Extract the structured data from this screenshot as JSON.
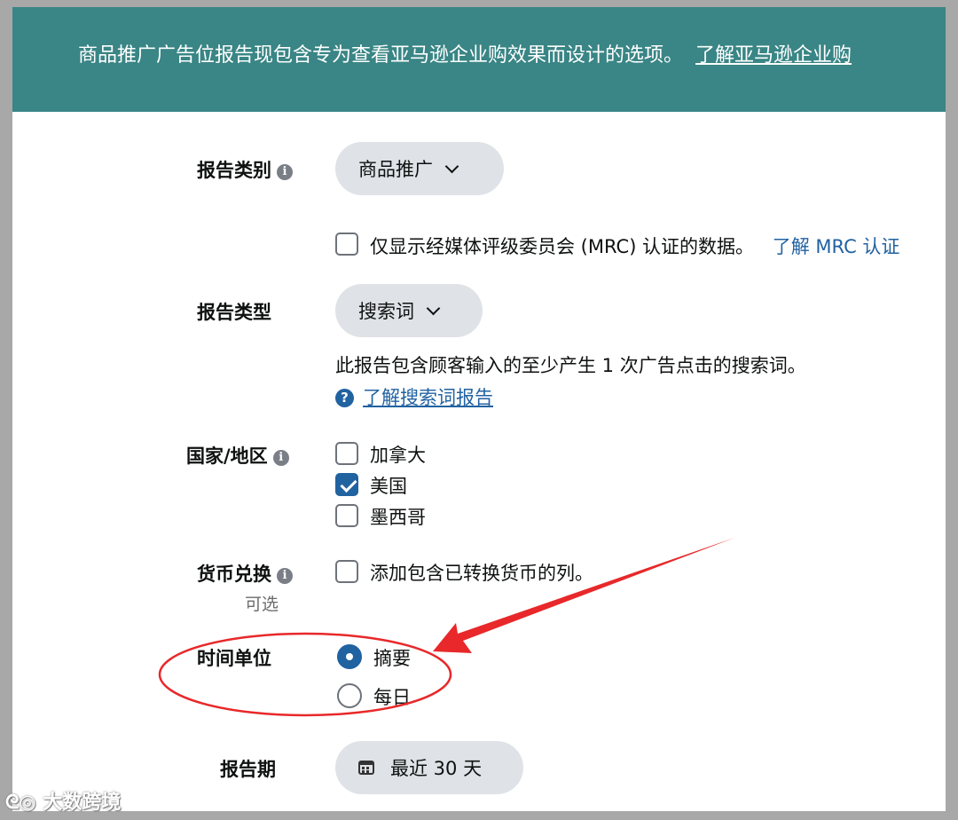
{
  "banner": {
    "text": "商品推广广告位报告现包含专为查看亚马逊企业购效果而设计的选项。",
    "link": "了解亚马逊企业购"
  },
  "report_category": {
    "label": "报告类别",
    "value": "商品推广",
    "mrc_text": "仅显示经媒体评级委员会 (MRC) 认证的数据。",
    "mrc_link": "了解 MRC 认证"
  },
  "report_type": {
    "label": "报告类型",
    "value": "搜索词",
    "description": "此报告包含顾客输入的至少产生 1 次广告点击的搜索词。",
    "help_link": "了解搜索词报告"
  },
  "country": {
    "label": "国家/地区",
    "options": [
      {
        "label": "加拿大",
        "checked": false
      },
      {
        "label": "美国",
        "checked": true
      },
      {
        "label": "墨西哥",
        "checked": false
      }
    ]
  },
  "currency": {
    "label": "货币兑换",
    "optional": "可选",
    "option": "添加包含已转换货币的列。"
  },
  "time_unit": {
    "label": "时间单位",
    "options": [
      {
        "label": "摘要",
        "selected": true
      },
      {
        "label": "每日",
        "selected": false
      }
    ]
  },
  "report_period": {
    "label": "报告期",
    "value": "最近 30 天"
  },
  "annotation_color": "#e8282a",
  "watermark": "大数跨境"
}
